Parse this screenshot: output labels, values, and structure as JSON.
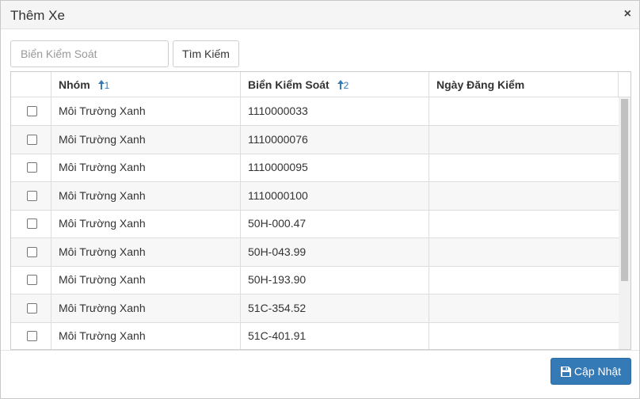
{
  "dialog": {
    "title": "Thêm Xe",
    "close_glyph": "×"
  },
  "search": {
    "placeholder": "Biển Kiểm Soát",
    "value": "",
    "button_label": "Tìm Kiếm"
  },
  "grid": {
    "columns": [
      {
        "label": "",
        "type": "checkbox"
      },
      {
        "label": "Nhóm",
        "sort_order": "1",
        "sort_direction": "ascending"
      },
      {
        "label": "Biển Kiểm Soát",
        "sort_order": "2",
        "sort_direction": "ascending"
      },
      {
        "label": "Ngày Đăng Kiểm"
      }
    ],
    "rows": [
      {
        "checked": false,
        "group": "Môi Trường Xanh",
        "plate": "1110000033",
        "inspection_date": ""
      },
      {
        "checked": false,
        "group": "Môi Trường Xanh",
        "plate": "1110000076",
        "inspection_date": ""
      },
      {
        "checked": false,
        "group": "Môi Trường Xanh",
        "plate": "1110000095",
        "inspection_date": ""
      },
      {
        "checked": false,
        "group": "Môi Trường Xanh",
        "plate": "1110000100",
        "inspection_date": ""
      },
      {
        "checked": false,
        "group": "Môi Trường Xanh",
        "plate": "50H-000.47",
        "inspection_date": ""
      },
      {
        "checked": false,
        "group": "Môi Trường Xanh",
        "plate": "50H-043.99",
        "inspection_date": ""
      },
      {
        "checked": false,
        "group": "Môi Trường Xanh",
        "plate": "50H-193.90",
        "inspection_date": ""
      },
      {
        "checked": false,
        "group": "Môi Trường Xanh",
        "plate": "51C-354.52",
        "inspection_date": ""
      },
      {
        "checked": false,
        "group": "Môi Trường Xanh",
        "plate": "51C-401.91",
        "inspection_date": ""
      }
    ]
  },
  "footer": {
    "save_label": "Cập Nhật",
    "save_icon": "floppy-disk-icon"
  },
  "colors": {
    "primary": "#337ab7",
    "sort_indicator": "#337ab7"
  }
}
